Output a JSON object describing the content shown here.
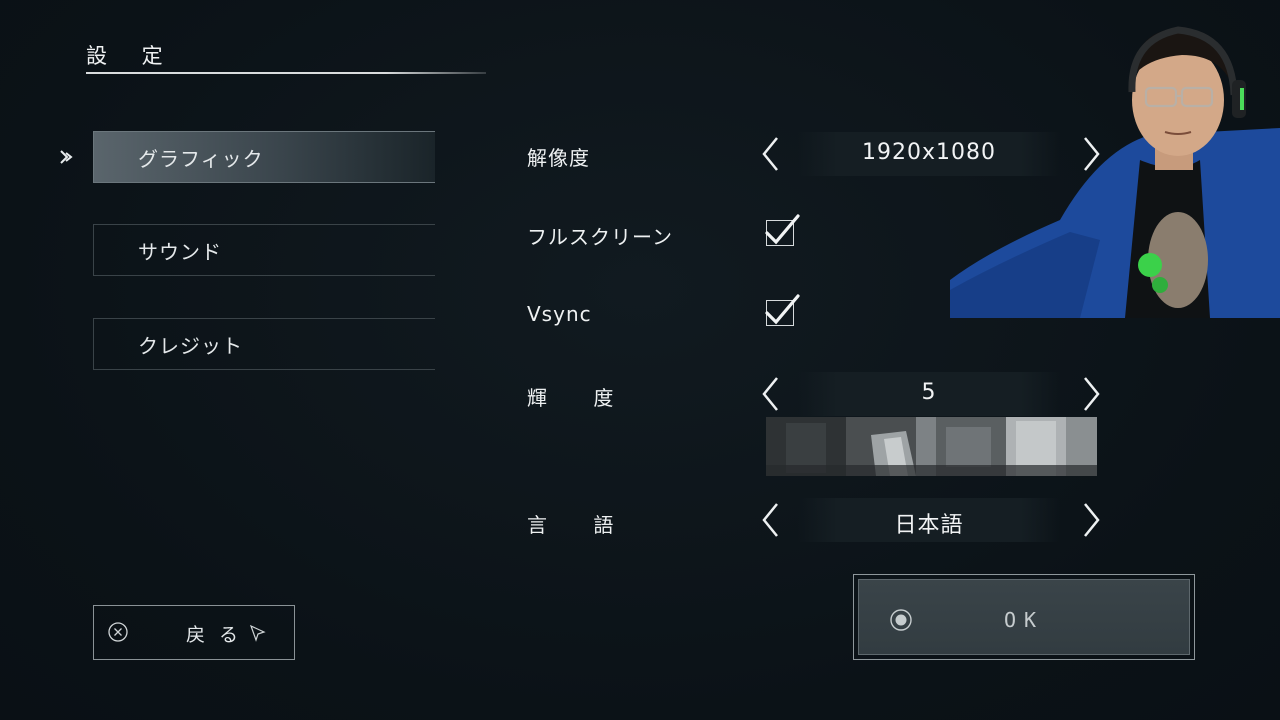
{
  "title": "設 定",
  "menu": {
    "items": [
      {
        "label": "グラフィック",
        "active": true
      },
      {
        "label": "サウンド",
        "active": false
      },
      {
        "label": "クレジット",
        "active": false
      }
    ]
  },
  "settings": {
    "resolution": {
      "label": "解像度",
      "value": "1920x1080"
    },
    "fullscreen": {
      "label": "フルスクリーン",
      "checked": true
    },
    "vsync": {
      "label": "Vsync",
      "checked": true
    },
    "brightness": {
      "label": "輝 度",
      "value": "5"
    },
    "language": {
      "label": "言 語",
      "value": "日本語"
    }
  },
  "buttons": {
    "back_label": "戻る",
    "ok_label": "OK"
  },
  "colors": {
    "background": "#0c1419",
    "text": "#e8ecee",
    "active_menu": "#5a656c",
    "ok_fill": "#3a4449"
  }
}
